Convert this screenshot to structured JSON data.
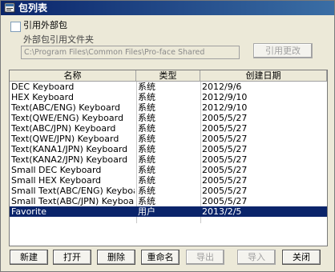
{
  "window": {
    "title": "包列表"
  },
  "external": {
    "checkbox_label": "引用外部包",
    "path_label": "外部包引用文件夹",
    "path_value": "C:\\Program Files\\Common Files\\Pro-face Shared",
    "cite_button": "引用更改"
  },
  "table": {
    "columns": {
      "name": "名称",
      "type": "类型",
      "date": "创建日期"
    },
    "rows": [
      {
        "name": "DEC Keyboard",
        "type": "系统",
        "date": "2012/9/6"
      },
      {
        "name": "HEX Keyboard",
        "type": "系统",
        "date": "2012/9/10"
      },
      {
        "name": "Text(ABC/ENG) Keyboard",
        "type": "系统",
        "date": "2012/9/10"
      },
      {
        "name": "Text(QWE/ENG) Keyboard",
        "type": "系统",
        "date": "2005/5/27"
      },
      {
        "name": "Text(ABC/JPN) Keyboard",
        "type": "系统",
        "date": "2005/5/27"
      },
      {
        "name": "Text(QWE/JPN) Keyboard",
        "type": "系统",
        "date": "2005/5/27"
      },
      {
        "name": "Text(KANA1/JPN) Keyboard",
        "type": "系统",
        "date": "2005/5/27"
      },
      {
        "name": "Text(KANA2/JPN) Keyboard",
        "type": "系统",
        "date": "2005/5/27"
      },
      {
        "name": "Small DEC Keyboard",
        "type": "系统",
        "date": "2005/5/27"
      },
      {
        "name": "Small HEX Keyboard",
        "type": "系统",
        "date": "2005/5/27"
      },
      {
        "name": "Small Text(ABC/ENG) Keyboard",
        "type": "系统",
        "date": "2005/5/27"
      },
      {
        "name": "Small Text(ABC/JPN) Keyboard",
        "type": "系统",
        "date": "2005/5/27"
      },
      {
        "name": "Favorite",
        "type": "用户",
        "date": "2013/2/5"
      }
    ],
    "selected_index": 12
  },
  "buttons": {
    "new": "新建",
    "open": "打开",
    "delete": "删除",
    "rename": "重命名",
    "export": "导出",
    "import": "导入",
    "close": "关闭"
  }
}
